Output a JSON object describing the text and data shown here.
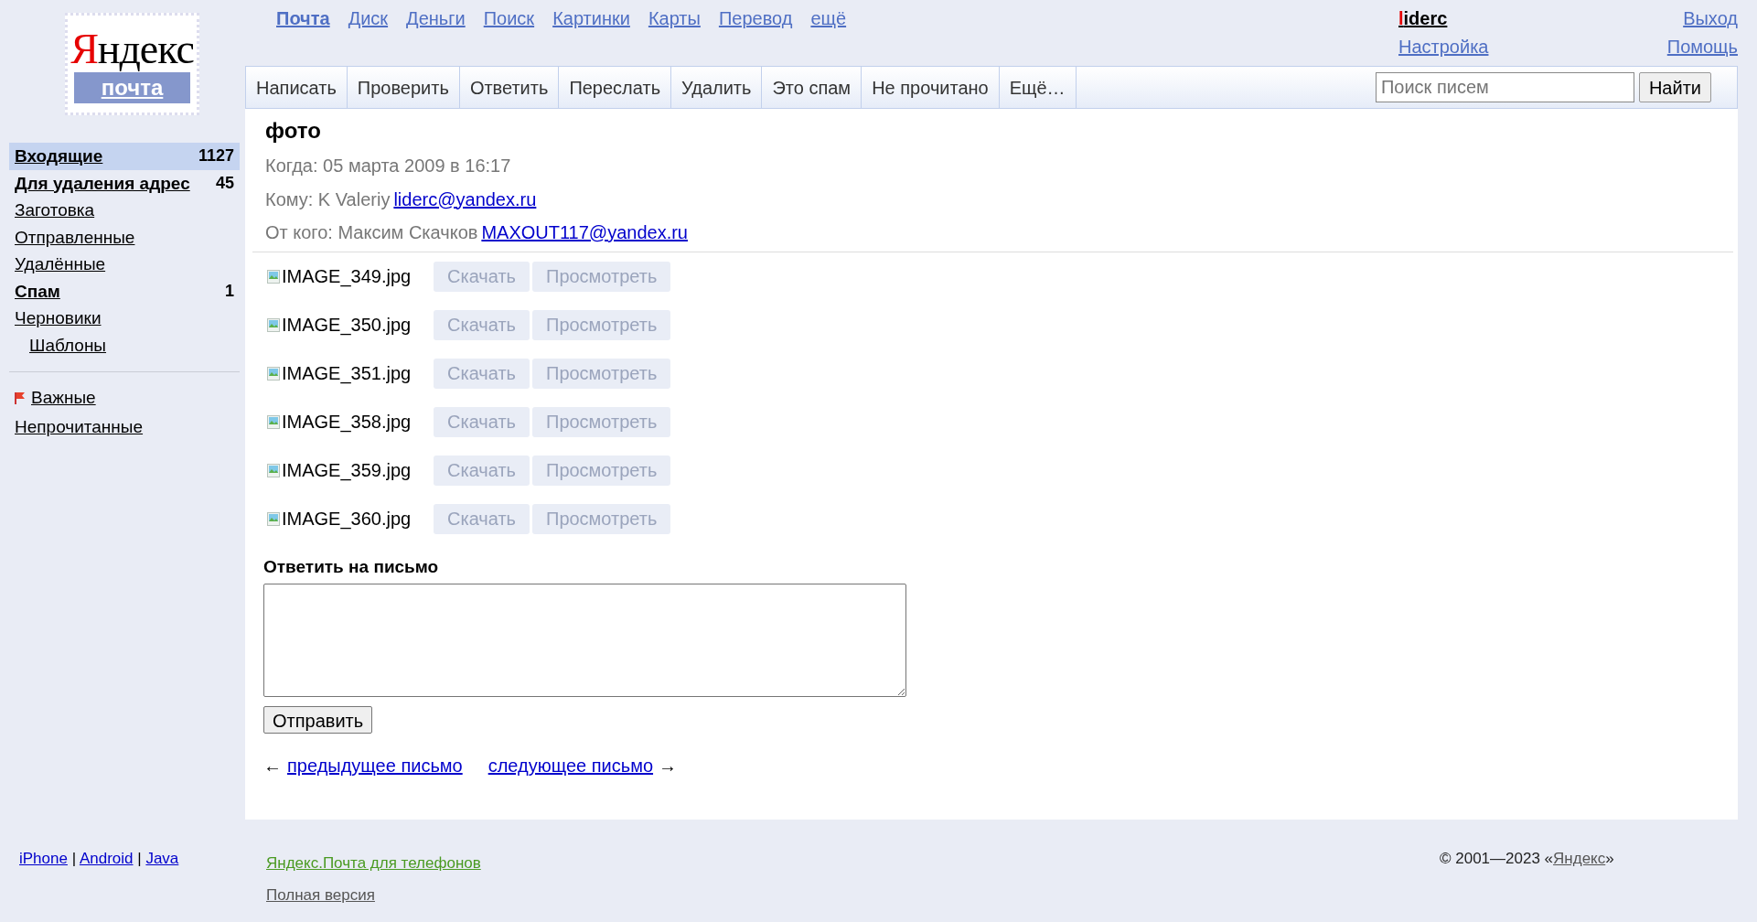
{
  "logo": {
    "brand": "Яндекс",
    "service": "почта"
  },
  "nav_links": [
    {
      "label": "Почта",
      "selected": true
    },
    {
      "label": "Диск",
      "selected": false
    },
    {
      "label": "Деньги",
      "selected": false
    },
    {
      "label": "Поиск",
      "selected": false
    },
    {
      "label": "Картинки",
      "selected": false
    },
    {
      "label": "Карты",
      "selected": false
    },
    {
      "label": "Перевод",
      "selected": false
    },
    {
      "label": "ещё",
      "selected": false
    }
  ],
  "user": {
    "login": "liderc",
    "links": [
      "Настройка"
    ],
    "right_links": [
      "Выход",
      "Помощь"
    ]
  },
  "toolbar": {
    "buttons": [
      "Написать",
      "Проверить",
      "Ответить",
      "Переслать",
      "Удалить",
      "Это спам",
      "Не прочитано",
      "Ещё…"
    ],
    "search": {
      "placeholder": "Поиск писем",
      "button": "Найти"
    }
  },
  "folders": [
    {
      "label": "Входящие",
      "count": "1127",
      "unread": true,
      "selected": true
    },
    {
      "label": "Для удаления адрес",
      "count": "45",
      "unread": true,
      "selected": false
    },
    {
      "label": "Заготовка",
      "unread": false,
      "selected": false
    },
    {
      "label": "Отправленные",
      "unread": false,
      "selected": false
    },
    {
      "label": "Удалённые",
      "unread": false,
      "selected": false
    },
    {
      "label": "Спам",
      "count": "1",
      "unread": true,
      "selected": false
    },
    {
      "label": "Черновики",
      "unread": false,
      "selected": false,
      "children": [
        {
          "label": "Шаблоны",
          "unread": false,
          "selected": false
        }
      ]
    }
  ],
  "filters": [
    {
      "label": "Важные",
      "kind": "flagged"
    },
    {
      "label": "Непрочитанные",
      "kind": "plain"
    }
  ],
  "message": {
    "subject": "фото",
    "when": "Когда: 05 марта 2009 в 16:17",
    "to": {
      "label": "Кому: K Valeriy",
      "email": "liderc@yandex.ru"
    },
    "from": {
      "label": "От кого: Максим Скачков",
      "email": "MAXOUT117@yandex.ru"
    },
    "attachments": [
      {
        "name": "IMAGE_349.jpg",
        "actions": [
          {
            "label": "Скачать",
            "disabled": true
          },
          {
            "label": "Просмотреть",
            "disabled": true
          }
        ]
      },
      {
        "name": "IMAGE_350.jpg",
        "actions": [
          {
            "label": "Скачать",
            "disabled": true
          },
          {
            "label": "Просмотреть",
            "disabled": true
          }
        ]
      },
      {
        "name": "IMAGE_351.jpg",
        "actions": [
          {
            "label": "Скачать",
            "disabled": true
          },
          {
            "label": "Просмотреть",
            "disabled": true
          }
        ]
      },
      {
        "name": "IMAGE_358.jpg",
        "actions": [
          {
            "label": "Скачать",
            "disabled": true
          },
          {
            "label": "Просмотреть",
            "disabled": true
          }
        ]
      },
      {
        "name": "IMAGE_359.jpg",
        "actions": [
          {
            "label": "Скачать",
            "disabled": true
          },
          {
            "label": "Просмотреть",
            "disabled": true
          }
        ]
      },
      {
        "name": "IMAGE_360.jpg",
        "actions": [
          {
            "label": "Скачать",
            "disabled": true
          },
          {
            "label": "Просмотреть",
            "disabled": true
          }
        ]
      }
    ]
  },
  "reply": {
    "title": "Ответить на письмо",
    "send": "Отправить"
  },
  "pager": {
    "prev_arrow": "←",
    "prev": "предыдущее письмо",
    "next": "следующее письмо",
    "next_arrow": "→"
  },
  "footer": {
    "apps": [
      "iPhone",
      "Android",
      "Java"
    ],
    "separator": "|",
    "mobile": "Яндекс.Почта для телефонов",
    "full": "Полная версия",
    "copyright_prefix": "© 2001—2023 «",
    "copyright_link": "Яндекс",
    "copyright_suffix": "»"
  }
}
